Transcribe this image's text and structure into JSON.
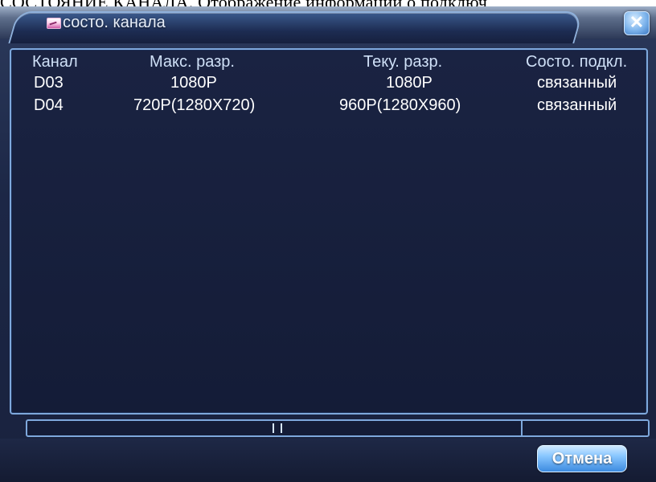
{
  "page_caption": "СОСТОЯНИЕ КАНАЛА. Отображение информации о подключ",
  "window": {
    "title": "состо. канала",
    "close_glyph": "✕"
  },
  "table": {
    "headers": [
      "Канал",
      "Макс. разр.",
      "Теку. разр.",
      "Состо. подкл."
    ],
    "rows": [
      [
        "D03",
        "1080P",
        "1080P",
        "связанный"
      ],
      [
        "D04",
        "720P(1280X720)",
        "960P(1280X960)",
        "связанный"
      ]
    ]
  },
  "buttons": {
    "cancel_label": "Отмена"
  },
  "colors": {
    "background": "#19223e",
    "border_accent": "#7ea8dc",
    "button_accent": "#3d8be0"
  },
  "icons": {
    "title_icon": "mail-icon",
    "close_icon": "close-icon"
  }
}
